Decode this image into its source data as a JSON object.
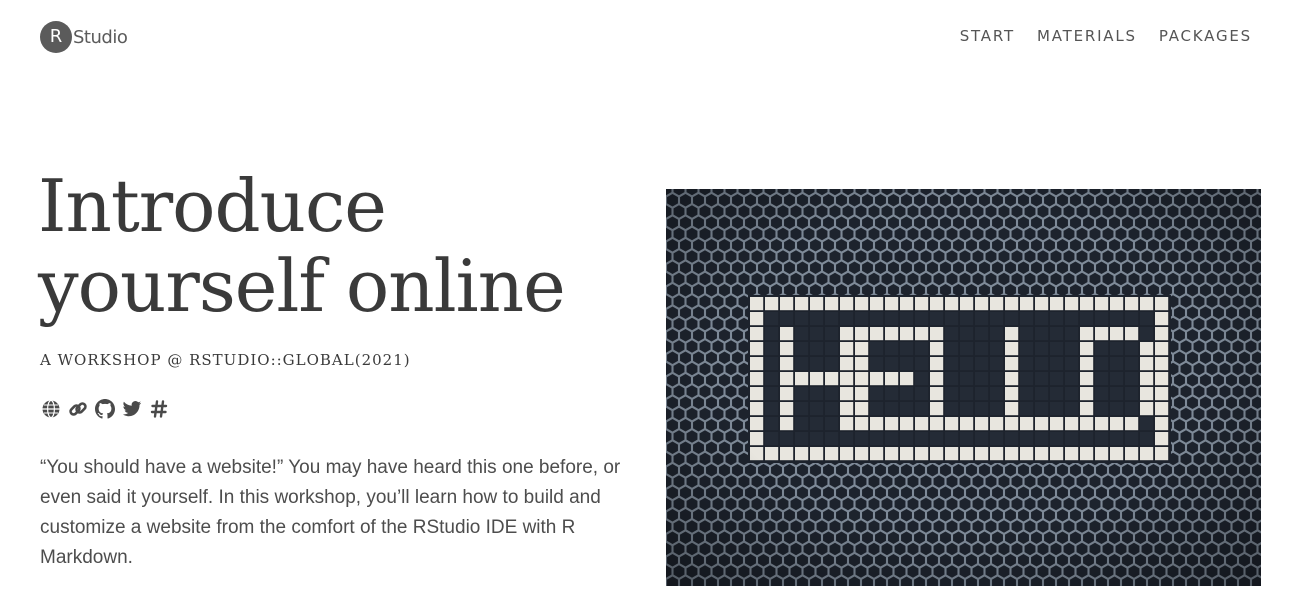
{
  "header": {
    "logo": {
      "letter": "R",
      "text": "Studio"
    },
    "nav": [
      {
        "label": "START"
      },
      {
        "label": "MATERIALS"
      },
      {
        "label": "PACKAGES"
      }
    ]
  },
  "hero": {
    "title_line1": "Introduce",
    "title_line2": "yourself online",
    "subtitle": "A WORKSHOP @ RSTUDIO::GLOBAL(2021)",
    "icons": [
      "globe-icon",
      "link-icon",
      "github-icon",
      "twitter-icon",
      "hashtag-icon"
    ],
    "description": "“You should have a website!” You may have heard this one before, or even said it yourself. In this workshop, you’ll learn how to build and customize a website from the comfort of the RStudio IDE with R Markdown."
  },
  "image": {
    "word": "HELLO",
    "colors": {
      "tile": "#e8e6df",
      "grout": "#1d232d",
      "hex": "#2b333f"
    }
  },
  "colors": {
    "text": "#404040",
    "nav": "#555555"
  }
}
